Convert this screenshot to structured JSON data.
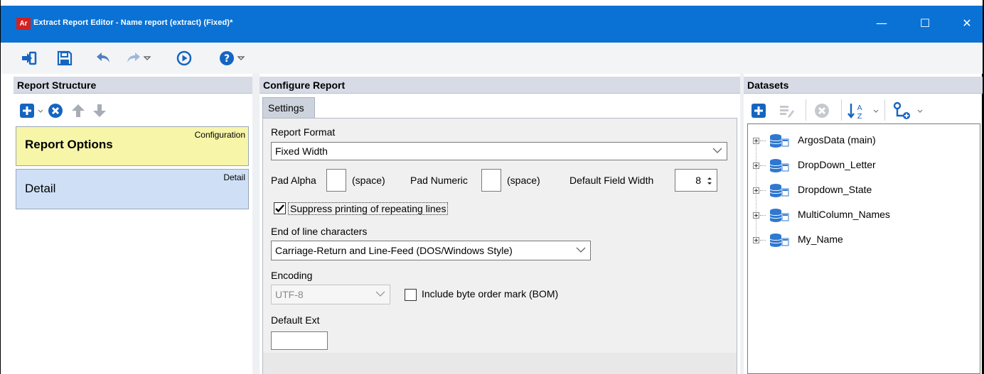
{
  "window": {
    "app_icon": "Ar",
    "title": "Extract Report Editor - Name report (extract) (Fixed)*",
    "minimize": "—",
    "maximize": "☐",
    "close": "✕"
  },
  "toolbar": {
    "icons": [
      "exit-icon",
      "save-icon",
      "undo-icon",
      "redo-icon",
      "run-icon",
      "help-icon"
    ]
  },
  "report_structure": {
    "heading": "Report Structure",
    "tools": [
      "add-icon",
      "delete-icon",
      "move-up-icon",
      "move-down-icon"
    ],
    "cards": [
      {
        "title": "Report Options",
        "tag": "Configuration",
        "color": "#f7f5a8"
      },
      {
        "title": "Detail",
        "tag": "Detail",
        "color": "#cfe0f6"
      }
    ]
  },
  "configure_report": {
    "heading": "Configure Report",
    "tab": "Settings",
    "report_format_label": "Report Format",
    "report_format_value": "Fixed Width",
    "pad_alpha_label": "Pad Alpha",
    "pad_alpha_value": "",
    "pad_alpha_hint": "(space)",
    "pad_numeric_label": "Pad Numeric",
    "pad_numeric_value": "",
    "pad_numeric_hint": "(space)",
    "default_field_width_label": "Default Field Width",
    "default_field_width_value": "8",
    "suppress_label": "Suppress printing of repeating lines",
    "suppress_checked": true,
    "eol_label": "End of line characters",
    "eol_value": "Carriage-Return and Line-Feed (DOS/Windows Style)",
    "encoding_label": "Encoding",
    "encoding_value": "UTF-8",
    "bom_label": "Include byte order mark (BOM)",
    "bom_checked": false,
    "default_ext_label": "Default Ext",
    "default_ext_value": ""
  },
  "datasets": {
    "heading": "Datasets",
    "tools": [
      "add-dataset-icon",
      "edit-dataset-icon",
      "delete-dataset-icon",
      "sort-az-icon",
      "relationship-icon"
    ],
    "items": [
      "ArgosData (main)",
      "DropDown_Letter",
      "Dropdown_State",
      "MultiColumn_Names",
      "My_Name"
    ]
  },
  "colors": {
    "titlebar": "#0a72d5",
    "accent_blue": "#1565c0",
    "panel_header": "#d6dbe5"
  }
}
